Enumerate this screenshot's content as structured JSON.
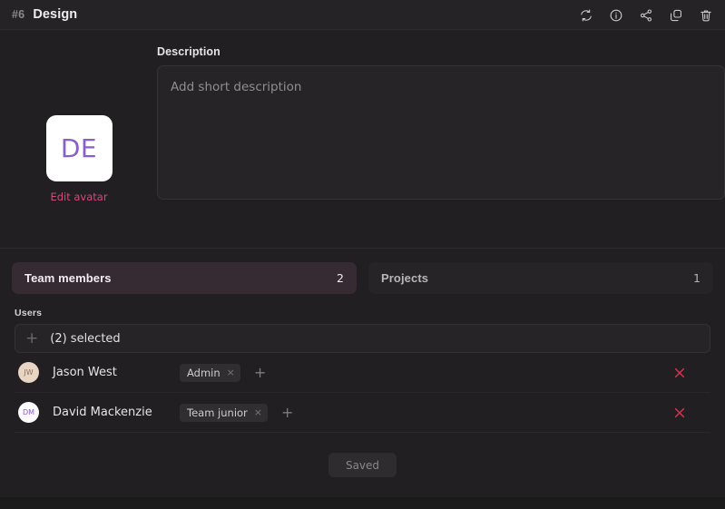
{
  "header": {
    "record_number": "#6",
    "title": "Design",
    "actions": [
      {
        "name": "sync-icon",
        "label": "Sync"
      },
      {
        "name": "info-icon",
        "label": "Info"
      },
      {
        "name": "share-icon",
        "label": "Share"
      },
      {
        "name": "duplicate-icon",
        "label": "Duplicate"
      },
      {
        "name": "trash-icon",
        "label": "Delete"
      }
    ]
  },
  "avatar": {
    "initials": "DE",
    "edit_label": "Edit avatar",
    "background": "#ffffff",
    "text_color": "#8a5fc6",
    "link_color": "#d14a80"
  },
  "description": {
    "label": "Description",
    "value": "",
    "placeholder": "Add short description"
  },
  "tabs": [
    {
      "label": "Team members",
      "count": "2",
      "active": true
    },
    {
      "label": "Projects",
      "count": "1",
      "active": false
    }
  ],
  "users": {
    "label": "Users",
    "selector": {
      "text": "(2) selected",
      "add_icon": "+"
    },
    "rows": [
      {
        "initials": "JW",
        "name": "Jason West",
        "avatar_bg": "#e8d5c4",
        "avatar_fg": "#8a7060",
        "chip": "Admin",
        "chip_remove": "×",
        "add_role": "+",
        "remove_color": "#d6334e"
      },
      {
        "initials": "DM",
        "name": "David Mackenzie",
        "avatar_bg": "#fdfbfe",
        "avatar_fg": "#8a5fc6",
        "chip": "Team junior",
        "chip_remove": "×",
        "add_role": "+",
        "remove_color": "#d6334e"
      }
    ]
  },
  "footer": {
    "save_label": "Saved"
  },
  "theme": {
    "page_bg": "#1c1b1c",
    "panel_bg": "#211f21",
    "header_bg": "#252325",
    "field_bg": "#262426",
    "tab_active_bg": "#362a33",
    "accent_pink": "#d14a80",
    "accent_purple": "#8a5fc6",
    "danger_red": "#d6334e"
  }
}
